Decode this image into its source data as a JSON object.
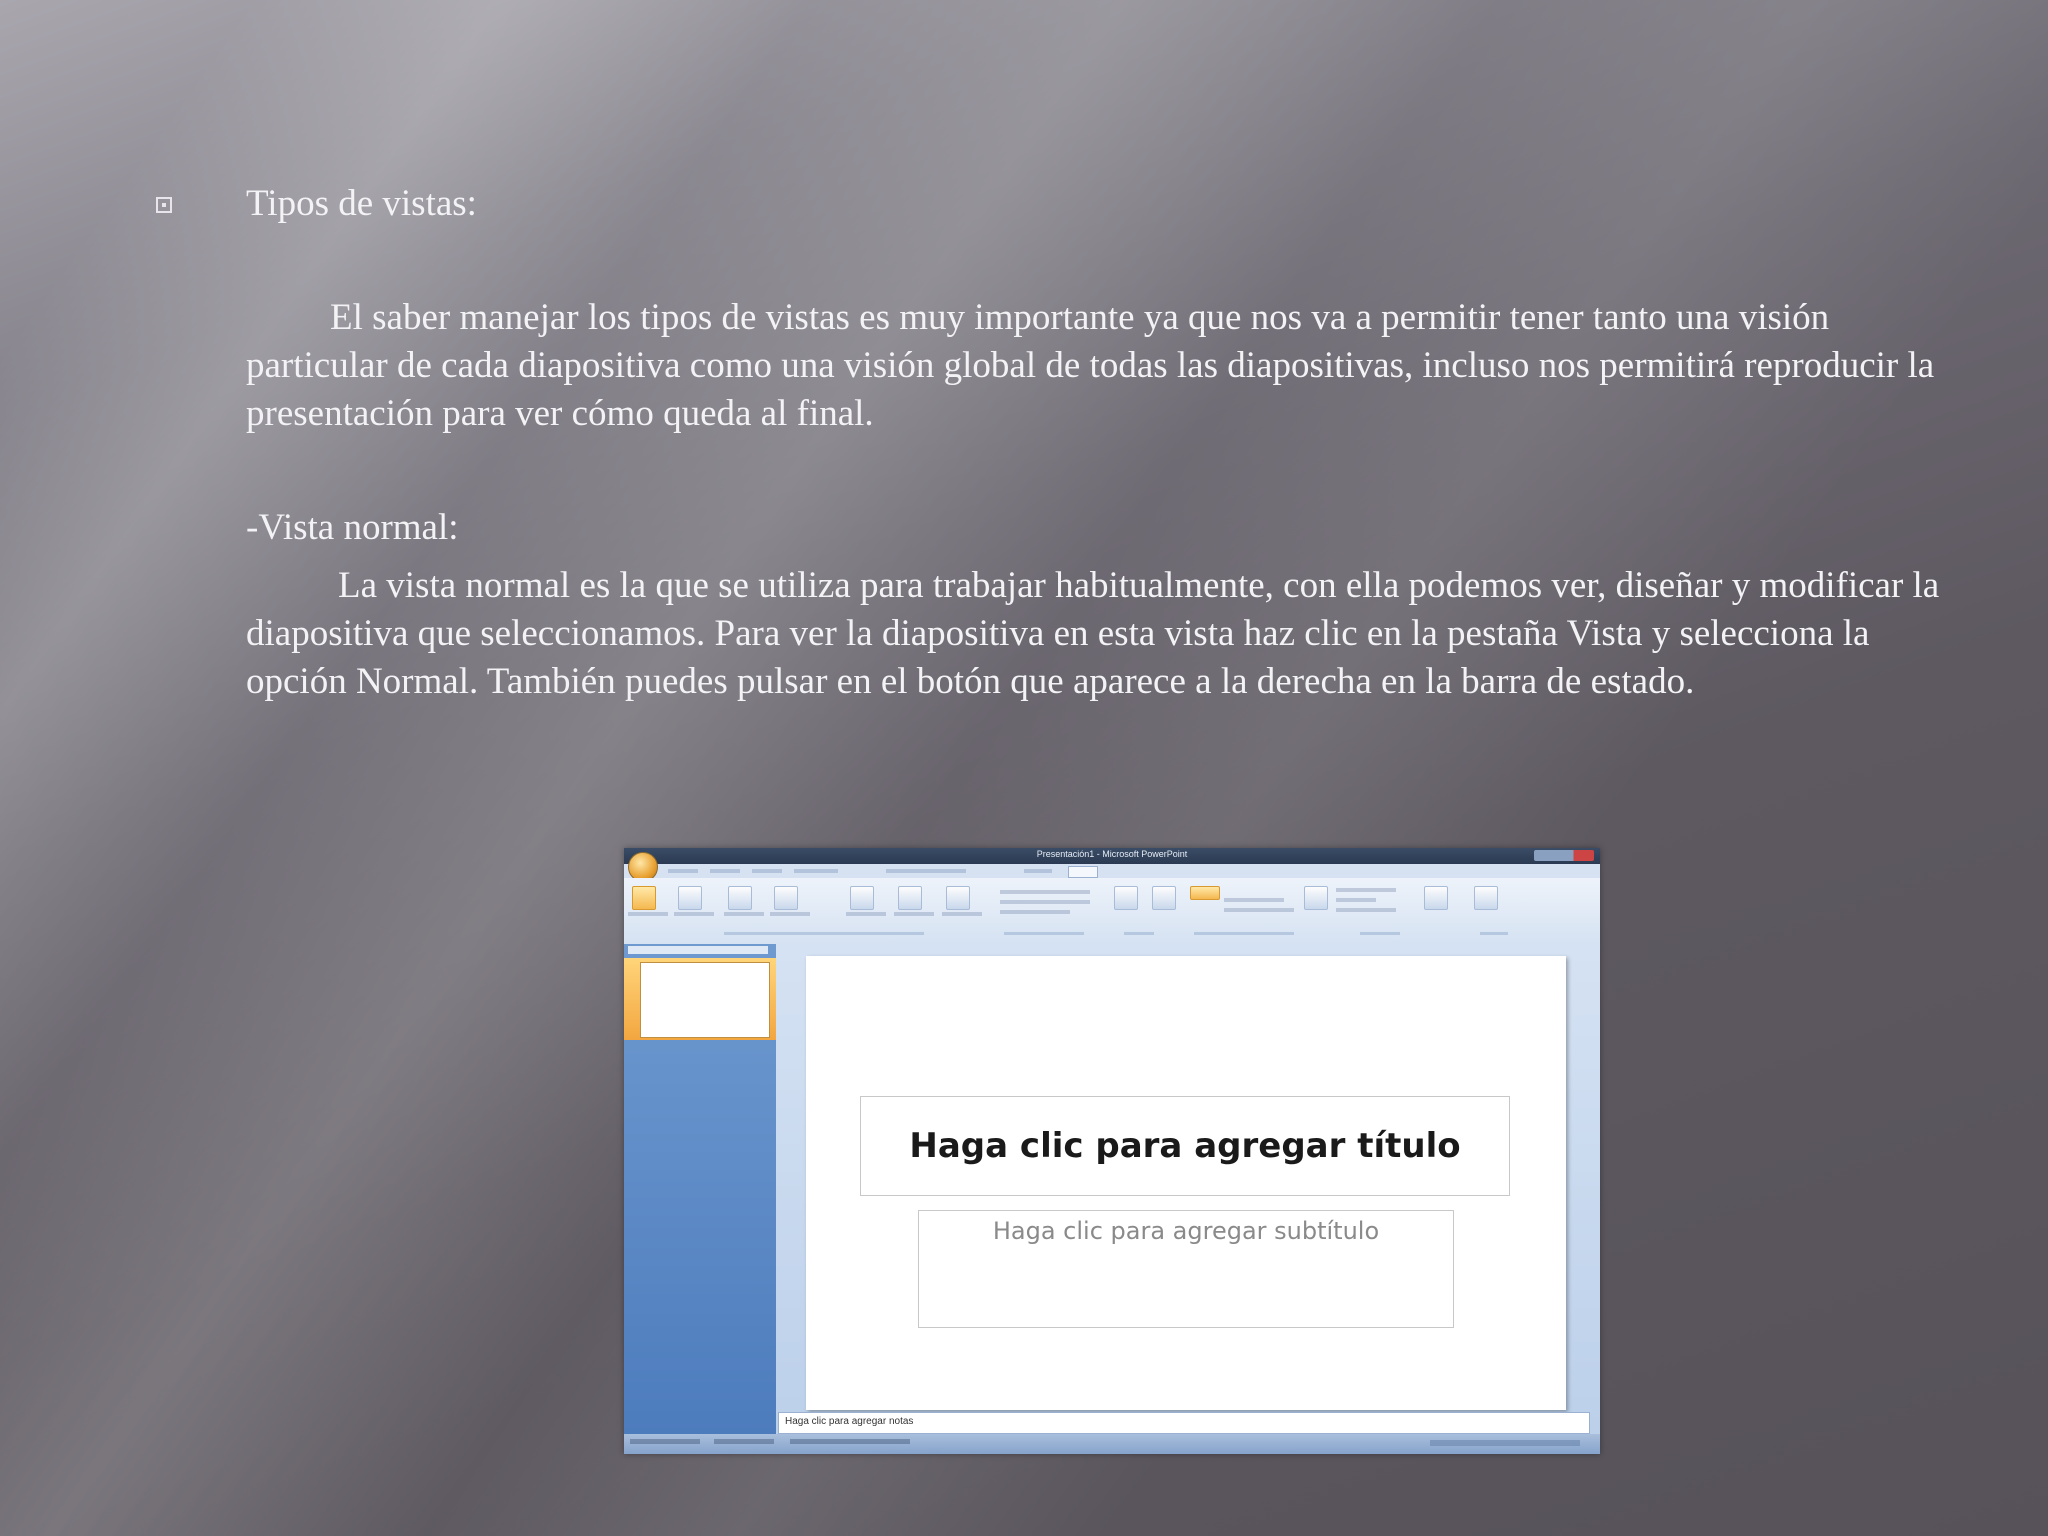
{
  "slide": {
    "heading": "Tipos de vistas:",
    "paragraph1": "El saber manejar los tipos de vistas es muy importante ya que nos va a permitir tener tanto una visión particular de cada diapositiva como una visión global de todas las diapositivas, incluso nos permitirá reproducir la presentación para ver cómo queda al final.",
    "sub_heading": "-Vista normal:",
    "paragraph2": "La vista normal es la que se utiliza para trabajar habitualmente, con ella podemos ver, diseñar y modificar la diapositiva que seleccionamos. Para ver la diapositiva en esta vista haz clic en la pestaña Vista y selecciona la opción Normal. También puedes pulsar en el botón que aparece a la derecha en la barra de estado."
  },
  "screenshot": {
    "window_title": "Presentación1 - Microsoft PowerPoint",
    "slide_title_placeholder": "Haga clic para agregar título",
    "slide_subtitle_placeholder": "Haga clic para agregar subtítulo",
    "notes_placeholder": "Haga clic para agregar notas"
  },
  "colors": {
    "background_dark": "#57525a",
    "background_light": "#a9a6ae",
    "text": "#f3f2f5",
    "office_blue": "#4d7cbd",
    "selected_orange": "#f3a640"
  }
}
